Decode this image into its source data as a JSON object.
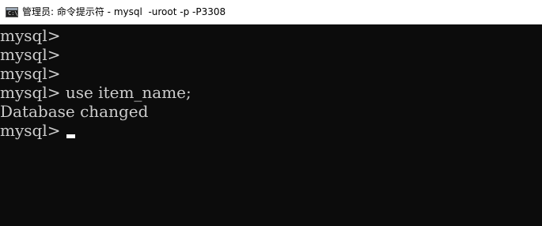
{
  "window": {
    "title": "管理员: 命令提示符 - mysql  -uroot -p -P3308",
    "icon": "cmd-icon"
  },
  "console": {
    "lines": [
      "mysql>",
      "mysql>",
      "mysql>",
      "mysql> use item_name;",
      "Database changed",
      "mysql> "
    ]
  },
  "colors": {
    "background": "#0c0c0c",
    "text": "#cccccc",
    "titlebar": "#ffffff"
  }
}
